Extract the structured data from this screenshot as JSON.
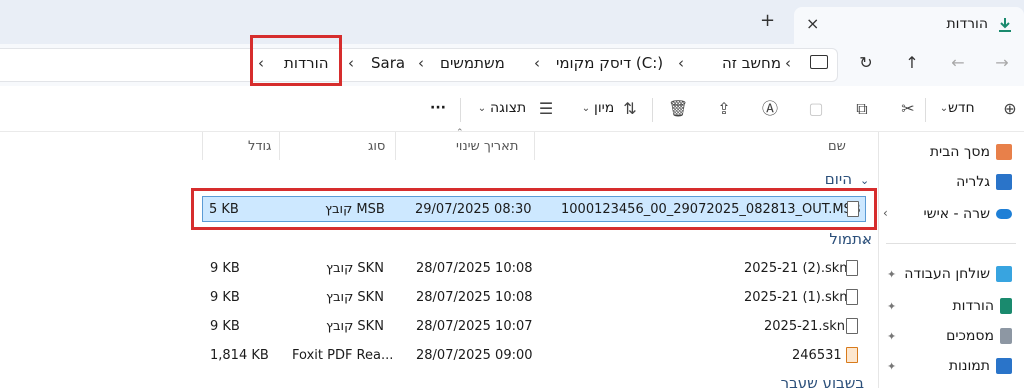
{
  "window": {
    "tab_title": "הורדות",
    "new_tab_symbol": "+",
    "close_symbol": "×"
  },
  "breadcrumb": [
    "מחשב זה",
    "דיסק מקומי (C:)",
    "משתמשים",
    "Sara",
    "הורדות"
  ],
  "toolbar": {
    "new_label": "חדש",
    "sort_label": "מיון",
    "view_label": "תצוגה",
    "more_label": "···"
  },
  "sidebar": {
    "top": [
      {
        "label": "מסך הבית",
        "icon": "home-icon"
      },
      {
        "label": "גלריה",
        "icon": "gallery-icon"
      },
      {
        "label": "שרה - אישי",
        "icon": "cloud-icon"
      }
    ],
    "quick": [
      {
        "label": "שולחן העבודה",
        "icon": "desktop-icon"
      },
      {
        "label": "הורדות",
        "icon": "download-icon"
      },
      {
        "label": "מסמכים",
        "icon": "documents-icon"
      },
      {
        "label": "תמונות",
        "icon": "pictures-icon"
      }
    ]
  },
  "columns": {
    "name": "שם",
    "date": "תאריך שינוי",
    "type": "סוג",
    "size": "גודל"
  },
  "groups": {
    "today": "היום",
    "yesterday": "אתמול",
    "earlier": "בשבוע שעבר"
  },
  "files_today": [
    {
      "name": "1000123456_00_29072025_082813_OUT.MSB",
      "date": "29/07/2025 08:30",
      "type": "קובץ MSB",
      "size": "5 KB"
    }
  ],
  "files_yesterday": [
    {
      "name": "2025-21 (2).skn",
      "date": "28/07/2025 10:08",
      "type": "קובץ SKN",
      "size": "9 KB"
    },
    {
      "name": "2025-21 (1).skn",
      "date": "28/07/2025 10:08",
      "type": "קובץ SKN",
      "size": "9 KB"
    },
    {
      "name": "2025-21.skn",
      "date": "28/07/2025 10:07",
      "type": "קובץ SKN",
      "size": "9 KB"
    },
    {
      "name": "246531",
      "date": "28/07/2025 09:00",
      "type": "Foxit PDF Rea...",
      "size": "1,814 KB"
    }
  ]
}
